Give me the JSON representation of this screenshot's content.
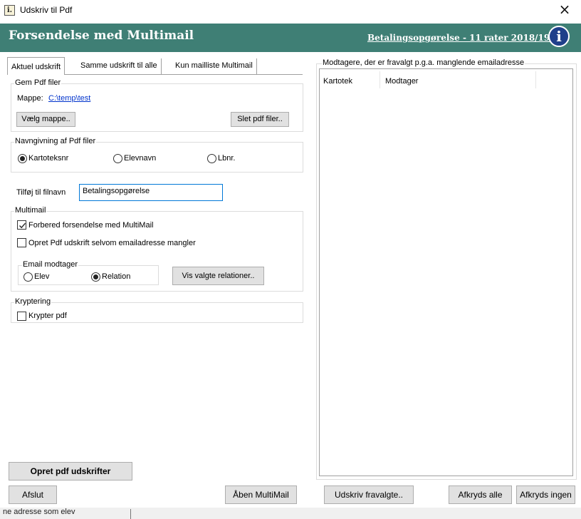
{
  "window": {
    "title": "Udskriv til Pdf",
    "icon_glyph": "i.",
    "close_glyph": "×"
  },
  "header": {
    "title": "Forsendelse med Multimail",
    "subtitle_link": "Betalingsopgørelse - 11 rater 2018/19",
    "info_glyph": "i",
    "background_color": "#3f7f75"
  },
  "tabs": [
    {
      "label": "Aktuel udskrift",
      "active": true
    },
    {
      "label": "Samme udskrift til alle",
      "active": false
    },
    {
      "label": "Kun mailliste Multimail",
      "active": false
    }
  ],
  "gem_pdf": {
    "legend": "Gem Pdf filer",
    "folder_label": "Mappe:",
    "folder_path": "C:\\temp\\test",
    "choose_folder_button": "Vælg mappe..",
    "delete_files_button": "Slet pdf filer.."
  },
  "naming": {
    "legend": "Navngivning af Pdf filer",
    "options": [
      {
        "label": "Kartoteksnr",
        "selected": true
      },
      {
        "label": "Elevnavn",
        "selected": false
      },
      {
        "label": "Lbnr.",
        "selected": false
      }
    ]
  },
  "filename": {
    "label": "Tilføj til filnavn",
    "value": "Betalingsopgørelse"
  },
  "multimail": {
    "legend": "Multimail",
    "prepare_checkbox": {
      "label": "Forbered forsendelse med MultiMail",
      "checked": true
    },
    "create_anyway_checkbox": {
      "label": "Opret Pdf udskrift selvom emailadresse mangler",
      "checked": false
    },
    "recipient": {
      "legend": "Email  modtager",
      "options": [
        {
          "label": "Elev",
          "selected": false
        },
        {
          "label": "Relation",
          "selected": true
        }
      ]
    },
    "show_relations_button": "Vis valgte relationer.."
  },
  "encryption": {
    "legend": "Kryptering",
    "encrypt_checkbox": {
      "label": "Krypter pdf",
      "checked": false
    }
  },
  "recipients_panel": {
    "legend": "Modtagere, der er fravalgt p.g.a. manglende emailadresse",
    "columns": [
      "Kartotek",
      "Modtager"
    ]
  },
  "buttons": {
    "create_pdf": "Opret pdf udskrifter",
    "close": "Afslut",
    "open_multimail": "Åben MultiMail",
    "print_deselected": "Udskriv fravalgte..",
    "check_all": "Afkryds alle",
    "uncheck_all": "Afkryds ingen"
  },
  "status_bar": {
    "text": "ne adresse som elev"
  }
}
